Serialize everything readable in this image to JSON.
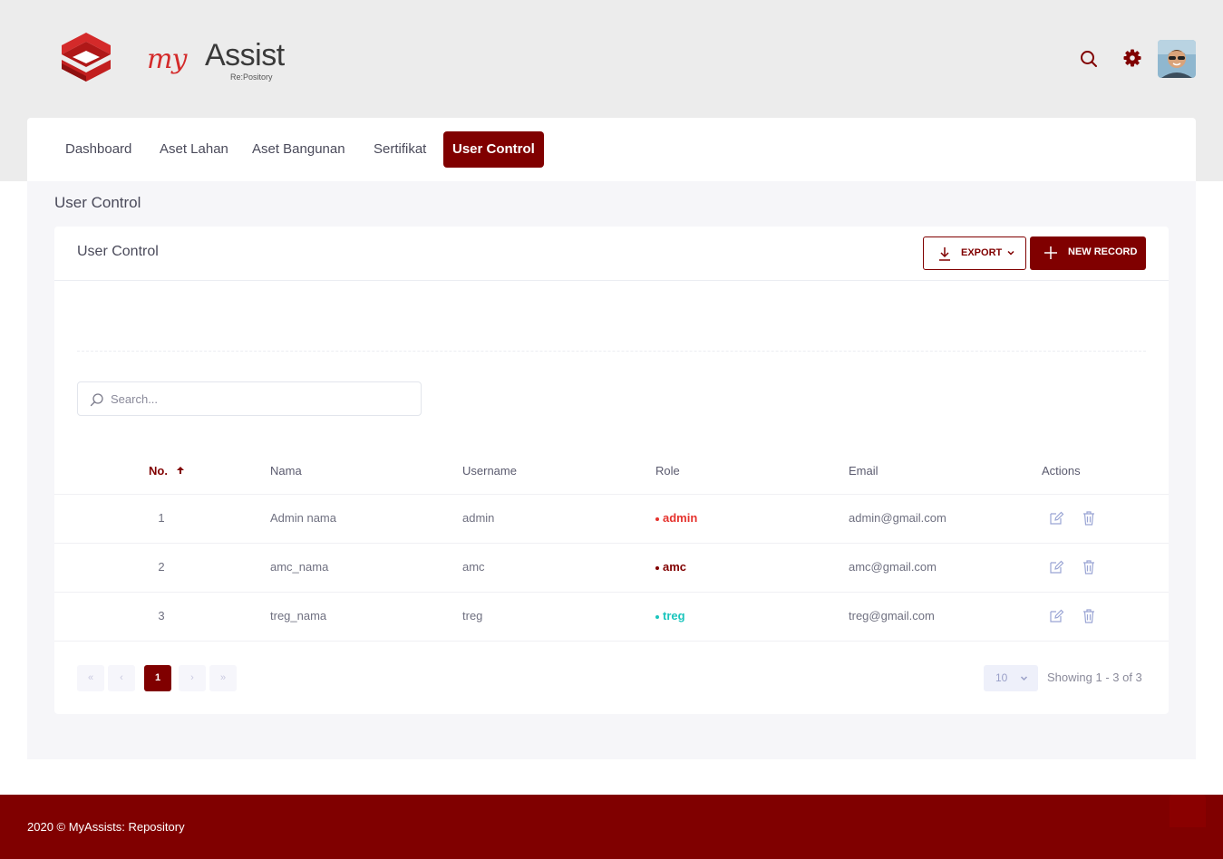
{
  "brand": {
    "logo_script": "my",
    "logo_name": "Assist",
    "logo_sub": "Re:Pository"
  },
  "header": {
    "search_icon": "search-icon",
    "settings_icon": "gear-icon",
    "avatar": "user-avatar"
  },
  "nav": {
    "items": [
      {
        "label": "Dashboard",
        "active": false
      },
      {
        "label": "Aset Lahan",
        "active": false
      },
      {
        "label": "Aset Bangunan",
        "active": false
      },
      {
        "label": "Sertifikat",
        "active": false
      },
      {
        "label": "User Control",
        "active": true
      }
    ]
  },
  "page": {
    "title": "User Control"
  },
  "card": {
    "title": "User Control",
    "export_label": "EXPORT",
    "new_label": "NEW RECORD",
    "search_placeholder": "Search..."
  },
  "table": {
    "columns": [
      "No.",
      "Nama",
      "Username",
      "Role",
      "Email",
      "Actions"
    ],
    "sorted_column": "No.",
    "sort_direction": "ascending",
    "rows": [
      {
        "no": "1",
        "nama": "Admin nama",
        "username": "admin",
        "role": "admin",
        "email": "admin@gmail.com"
      },
      {
        "no": "2",
        "nama": "amc_nama",
        "username": "amc",
        "role": "amc",
        "email": "amc@gmail.com"
      },
      {
        "no": "3",
        "nama": "treg_nama",
        "username": "treg",
        "role": "treg",
        "email": "treg@gmail.com"
      }
    ]
  },
  "role_colors": {
    "admin": "#e5322d",
    "amc": "#800000",
    "treg": "#1bc5bd"
  },
  "pagination": {
    "current_page": "1",
    "page_size": "10",
    "info": "Showing 1 - 3 of 3"
  },
  "footer": {
    "text": "2020 © MyAssists: Repository"
  },
  "colors": {
    "primary": "#800000",
    "background": "#ececec",
    "accent_red": "#d42a2a"
  }
}
